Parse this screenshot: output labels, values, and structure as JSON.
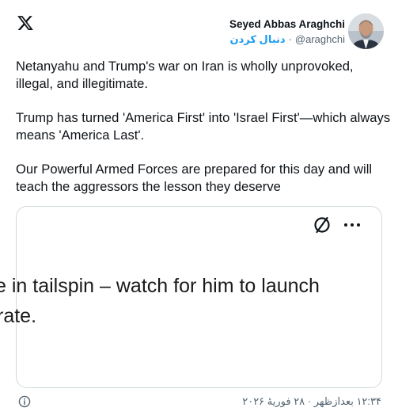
{
  "icons": {
    "logo": "x-logo-icon",
    "no_image": "slashed-circle-icon",
    "more": "more-horizontal-icon",
    "info": "info-circle-icon"
  },
  "author": {
    "name": "Seyed Abbas Araghchi",
    "follow_label": "دنبال کردن",
    "separator": "·",
    "handle": "@araghchi"
  },
  "tweet": {
    "paragraph_1": "Netanyahu and Trump's war on Iran is wholly unprovoked, illegal, and illegitimate.",
    "paragraph_2": "Trump has turned 'America First' into 'Israel First'—which always means 'America Last'.",
    "paragraph_3": "Our Powerful Armed Forces are prepared for this day and will teach the aggressors the lesson they deserve"
  },
  "card": {
    "line_1": "e in tailspin – watch for him to launch",
    "line_2": "rate."
  },
  "footer": {
    "timestamp": "۱۲:۳۴ بعدازظهر · ۲۸ فوریهٔ ۲۰۲۶"
  },
  "colors": {
    "accent": "#1d9bf0",
    "text": "#0f1419",
    "muted": "#536471",
    "border": "#cfd9de"
  }
}
